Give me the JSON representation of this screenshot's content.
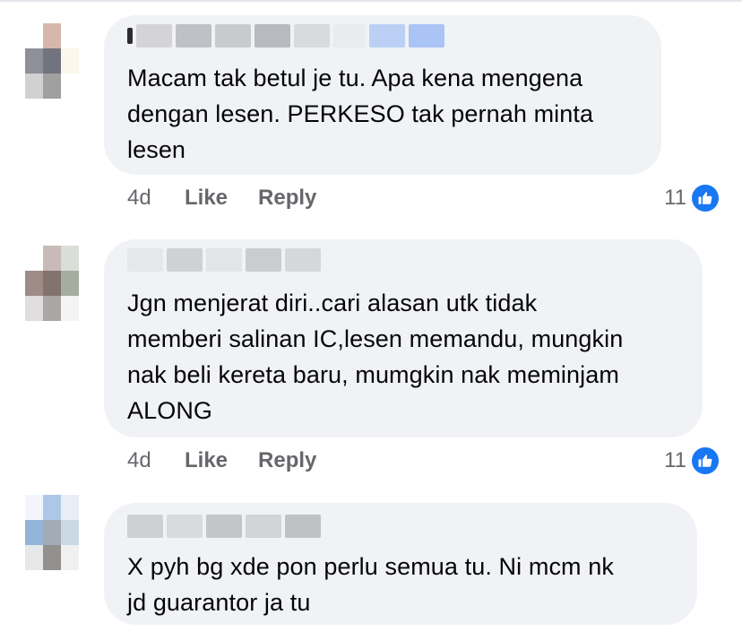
{
  "comments": [
    {
      "text": "Macam tak betul je tu. Apa kena mengena\ndengan lesen. PERKESO tak pernah minta\nlesen",
      "time": "4d",
      "like_label": "Like",
      "reply_label": "Reply",
      "reaction_count": "11"
    },
    {
      "text": "Jgn menjerat diri..cari alasan utk tidak\nmemberi salinan IC,lesen memandu, mungkin\nnak beli kereta baru, mumgkin nak meminjam\nALONG",
      "time": "4d",
      "like_label": "Like",
      "reply_label": "Reply",
      "reaction_count": "11"
    },
    {
      "text": "X pyh bg xde pon perlu semua tu. Ni mcm nk\njd guarantor ja tu"
    }
  ],
  "colors": {
    "bubble": "#f0f2f5",
    "text": "#050505",
    "meta": "#65676b",
    "like_blue": "#1877f2"
  },
  "icons": {
    "reaction": "like-thumb-icon"
  }
}
